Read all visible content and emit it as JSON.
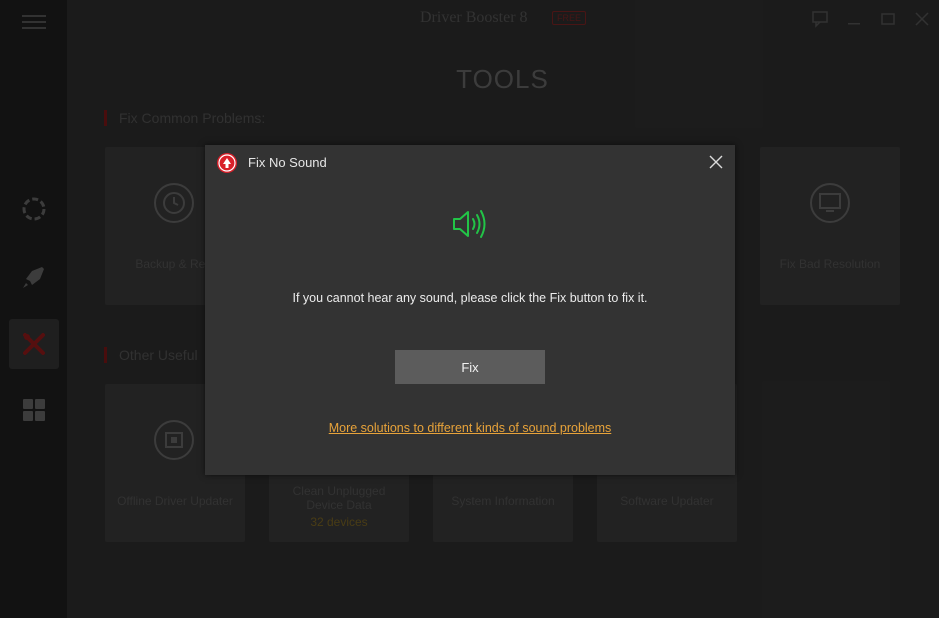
{
  "app": {
    "title": "Driver Booster 8",
    "badge": "FREE"
  },
  "page": {
    "title": "TOOLS"
  },
  "sections": {
    "fix_common": "Fix Common Problems:",
    "other_useful": "Other Useful"
  },
  "tools_row1": [
    {
      "label": "Backup & Rest",
      "icon": "backup-restore-icon"
    },
    {
      "label": "Fix Bad Resolution",
      "icon": "monitor-icon"
    }
  ],
  "tools_row2": [
    {
      "label": "Offline Driver Updater",
      "icon": "offline-driver-icon"
    },
    {
      "label": "Clean Unplugged Device Data",
      "sub": "32 devices"
    },
    {
      "label": "System Information"
    },
    {
      "label": "Software Updater"
    }
  ],
  "sidebar": {
    "items": [
      {
        "name": "menu-icon"
      },
      {
        "name": "scan-icon"
      },
      {
        "name": "boost-rocket-icon"
      },
      {
        "name": "tools-icon",
        "active": true
      },
      {
        "name": "action-center-icon"
      }
    ]
  },
  "dialog": {
    "title": "Fix No Sound",
    "message": "If you cannot hear any sound, please click the Fix button to fix it.",
    "fix_button": "Fix",
    "link": "More solutions to different kinds of sound problems"
  },
  "colors": {
    "accent_green": "#22c447",
    "link_orange": "#e8a33a",
    "brand_red": "#d8202a"
  }
}
